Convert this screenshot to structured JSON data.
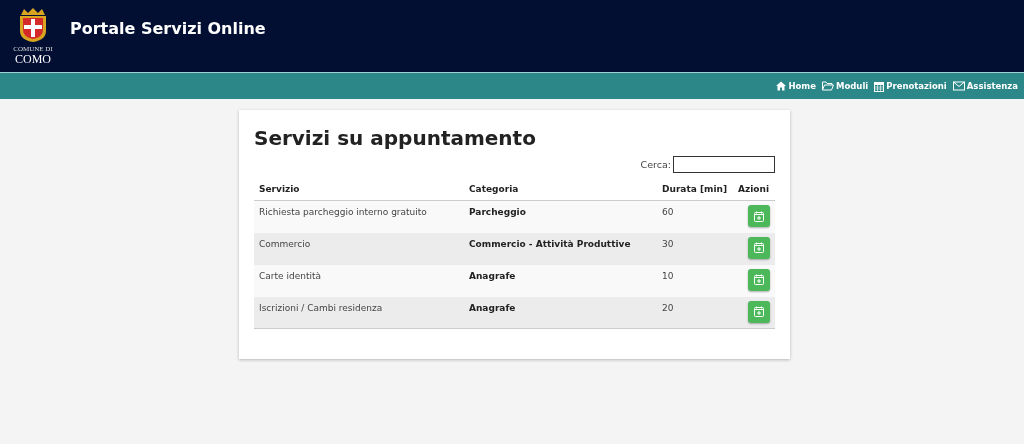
{
  "header": {
    "logo": {
      "line_1": "COMUNE DI",
      "line_2": "COMO"
    },
    "title": "Portale Servizi Online"
  },
  "nav": [
    {
      "label": "Home",
      "kind": "home"
    },
    {
      "label": "Moduli",
      "kind": "folder"
    },
    {
      "label": "Prenotazioni",
      "kind": "calendar"
    },
    {
      "label": "Assistenza",
      "kind": "mail"
    }
  ],
  "card": {
    "title": "Servizi su appuntamento",
    "search": {
      "label": "Cerca:"
    },
    "table": {
      "columns": [
        "Servizio",
        "Categoria",
        "Durata [min]",
        "Azioni"
      ],
      "rows": [
        {
          "servizio": "Richiesta parcheggio interno gratuito",
          "categoria": "Parcheggio",
          "durata": "60"
        },
        {
          "servizio": "Commercio",
          "categoria": "Commercio - Attività Produttive",
          "durata": "30"
        },
        {
          "servizio": "Carte identità",
          "categoria": "Anagrafe",
          "durata": "10"
        },
        {
          "servizio": "Iscrizioni / Cambi residenza",
          "categoria": "Anagrafe",
          "durata": "20"
        }
      ]
    }
  }
}
